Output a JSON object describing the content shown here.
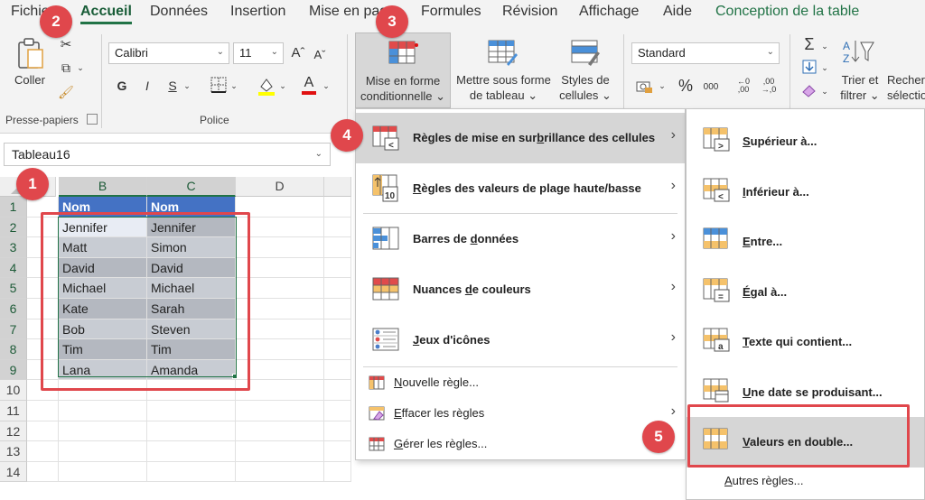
{
  "ribbon": {
    "tabs": [
      "Fichier",
      "Accueil",
      "Données",
      "Insertion",
      "Mise en page",
      "Formules",
      "Révision",
      "Affichage",
      "Aide",
      "Conception de la table"
    ],
    "active_tab": "Accueil",
    "clipboard": {
      "paste_label": "Coller",
      "group_label": "Presse-papiers"
    },
    "font": {
      "name": "Calibri",
      "size": "11",
      "bold": "G",
      "italic": "I",
      "underline": "S",
      "group_label": "Police"
    },
    "styles": {
      "cond_format": [
        "Mise en forme",
        "conditionnelle ⌄"
      ],
      "format_table": [
        "Mettre sous forme",
        "de tableau ⌄"
      ],
      "cell_styles": [
        "Styles de",
        "cellules ⌄"
      ]
    },
    "number": {
      "format": "Standard",
      "percent": "%",
      "thousands": "000"
    },
    "editing": {
      "sort_filter": [
        "Trier et",
        "filtrer ⌄"
      ],
      "find_select": [
        "Recher",
        "sélectio"
      ]
    }
  },
  "namebox": {
    "value": "Tableau16"
  },
  "grid": {
    "columns": [
      "B",
      "C",
      "D"
    ],
    "rows": [
      "1",
      "2",
      "3",
      "4",
      "5",
      "6",
      "7",
      "8",
      "9",
      "10",
      "11",
      "12",
      "13",
      "14"
    ],
    "header": [
      "Nom",
      "Nom"
    ],
    "data": [
      [
        "Jennifer",
        "Jennifer"
      ],
      [
        "Matt",
        "Simon"
      ],
      [
        "David",
        "David"
      ],
      [
        "Michael",
        "Michael"
      ],
      [
        "Kate",
        "Sarah"
      ],
      [
        "Bob",
        "Steven"
      ],
      [
        "Tim",
        "Tim"
      ],
      [
        "Lana",
        "Amanda"
      ]
    ]
  },
  "menu1": {
    "items": [
      {
        "pre": "Règles de mise en sur",
        "u": "b",
        "post": "rillance des cellules"
      },
      {
        "pre": "",
        "u": "R",
        "post": "ègles des valeurs de plage haute/basse"
      },
      {
        "pre": "Barres de ",
        "u": "d",
        "post": "onnées"
      },
      {
        "pre": "Nuances ",
        "u": "d",
        "post": "e couleurs"
      },
      {
        "pre": "",
        "u": "J",
        "post": "eux d'icônes"
      }
    ],
    "small": [
      {
        "pre": "",
        "u": "N",
        "post": "ouvelle règle..."
      },
      {
        "pre": "",
        "u": "E",
        "post": "ffacer les règles"
      },
      {
        "pre": "",
        "u": "G",
        "post": "érer les règles..."
      }
    ]
  },
  "menu2": {
    "items": [
      {
        "pre": "",
        "u": "S",
        "post": "upérieur à..."
      },
      {
        "pre": "",
        "u": "I",
        "post": "nférieur à..."
      },
      {
        "pre": "",
        "u": "E",
        "post": "ntre..."
      },
      {
        "pre": "",
        "u": "É",
        "post": "gal à..."
      },
      {
        "pre": "",
        "u": "T",
        "post": "exte qui contient..."
      },
      {
        "pre": "",
        "u": "U",
        "post": "ne date se produisant..."
      },
      {
        "pre": "",
        "u": "V",
        "post": "aleurs en double..."
      }
    ],
    "other": {
      "pre": "",
      "u": "A",
      "post": "utres règles..."
    }
  },
  "badges": [
    "1",
    "2",
    "3",
    "4",
    "5"
  ],
  "colors": {
    "accent": "#217346",
    "table_header": "#4472c4",
    "badge": "#e0474c"
  }
}
